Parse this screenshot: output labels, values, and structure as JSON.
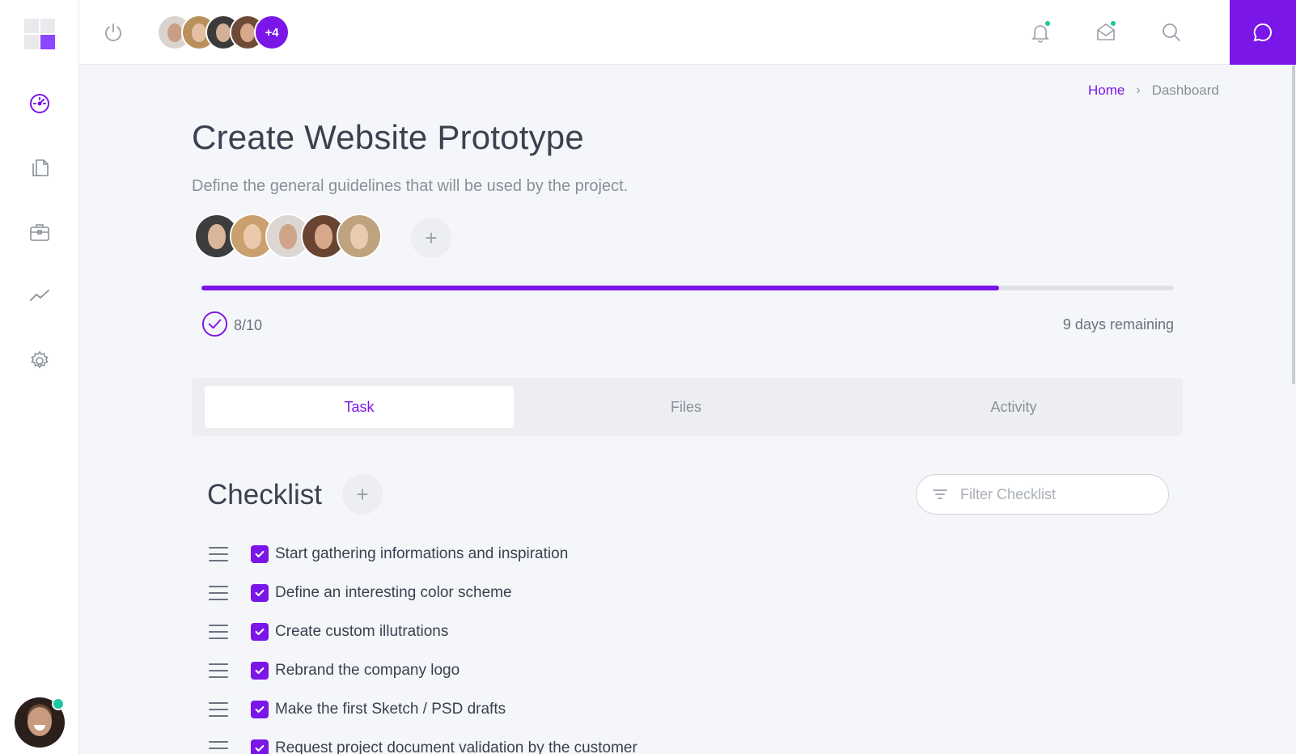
{
  "topbar": {
    "team_more": "+4",
    "icons": [
      "power-icon",
      "bell-icon",
      "mail-icon",
      "search-icon",
      "chat-icon"
    ]
  },
  "sidebar": {
    "items": [
      "dashboard-icon",
      "documents-icon",
      "briefcase-icon",
      "analytics-icon",
      "settings-icon"
    ]
  },
  "breadcrumb": {
    "home": "Home",
    "separator": "›",
    "current": "Dashboard"
  },
  "project": {
    "title": "Create Website Prototype",
    "subtitle": "Define the general guidelines that will be used by the project.",
    "add_member": "+",
    "progress_fraction": 0.82,
    "completed": "8/10",
    "remaining": "9 days remaining"
  },
  "tabs": [
    {
      "label": "Task",
      "active": true
    },
    {
      "label": "Files",
      "active": false
    },
    {
      "label": "Activity",
      "active": false
    }
  ],
  "checklist": {
    "title": "Checklist",
    "add_label": "+",
    "filter_placeholder": "Filter Checklist",
    "items": [
      {
        "label": "Start gathering informations and inspiration",
        "checked": true
      },
      {
        "label": "Define an interesting color scheme",
        "checked": true
      },
      {
        "label": "Create custom illutrations",
        "checked": true
      },
      {
        "label": "Rebrand the company logo",
        "checked": true
      },
      {
        "label": "Make the first Sketch / PSD drafts",
        "checked": true
      },
      {
        "label": "Request project document validation by the customer",
        "checked": true
      }
    ]
  },
  "colors": {
    "accent": "#7b16e8",
    "status_online": "#1dc7a0"
  }
}
